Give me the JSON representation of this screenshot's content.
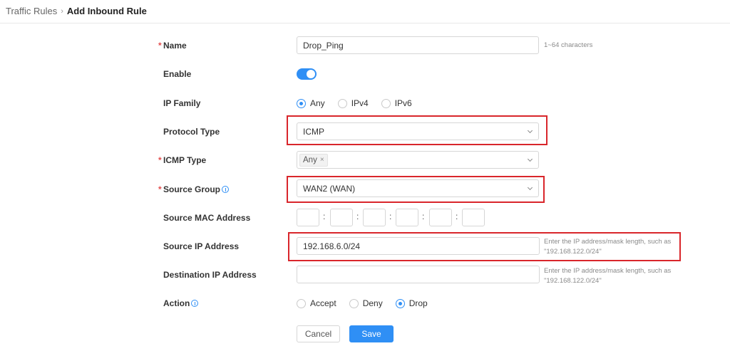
{
  "breadcrumb": {
    "parent": "Traffic Rules",
    "separator": "›",
    "current": "Add Inbound Rule"
  },
  "form": {
    "name": {
      "label": "Name",
      "value": "Drop_Ping",
      "hint": "1~64 characters",
      "required": true
    },
    "enable": {
      "label": "Enable",
      "on": true
    },
    "ip_family": {
      "label": "IP Family",
      "options": [
        "Any",
        "IPv4",
        "IPv6"
      ],
      "selected": "Any"
    },
    "protocol_type": {
      "label": "Protocol Type",
      "value": "ICMP"
    },
    "icmp_type": {
      "label": "ICMP Type",
      "tag": "Any",
      "tag_close": "×",
      "required": true
    },
    "source_group": {
      "label": "Source Group",
      "value": "WAN2 (WAN)",
      "required": true
    },
    "source_mac": {
      "label": "Source MAC Address",
      "separator": ":"
    },
    "source_ip": {
      "label": "Source IP Address",
      "value": "192.168.6.0/24",
      "hint_line1": "Enter the IP address/mask length, such as",
      "hint_line2": "\"192.168.122.0/24\""
    },
    "dest_ip": {
      "label": "Destination IP Address",
      "value": "",
      "hint_line1": "Enter the IP address/mask length, such as",
      "hint_line2": "\"192.168.122.0/24\""
    },
    "action": {
      "label": "Action",
      "options": [
        "Accept",
        "Deny",
        "Drop"
      ],
      "selected": "Drop"
    }
  },
  "buttons": {
    "cancel": "Cancel",
    "save": "Save"
  },
  "required_mark": "*",
  "colors": {
    "accent": "#2f8ff5",
    "highlight": "#d9262b",
    "required": "#e34d4d"
  }
}
